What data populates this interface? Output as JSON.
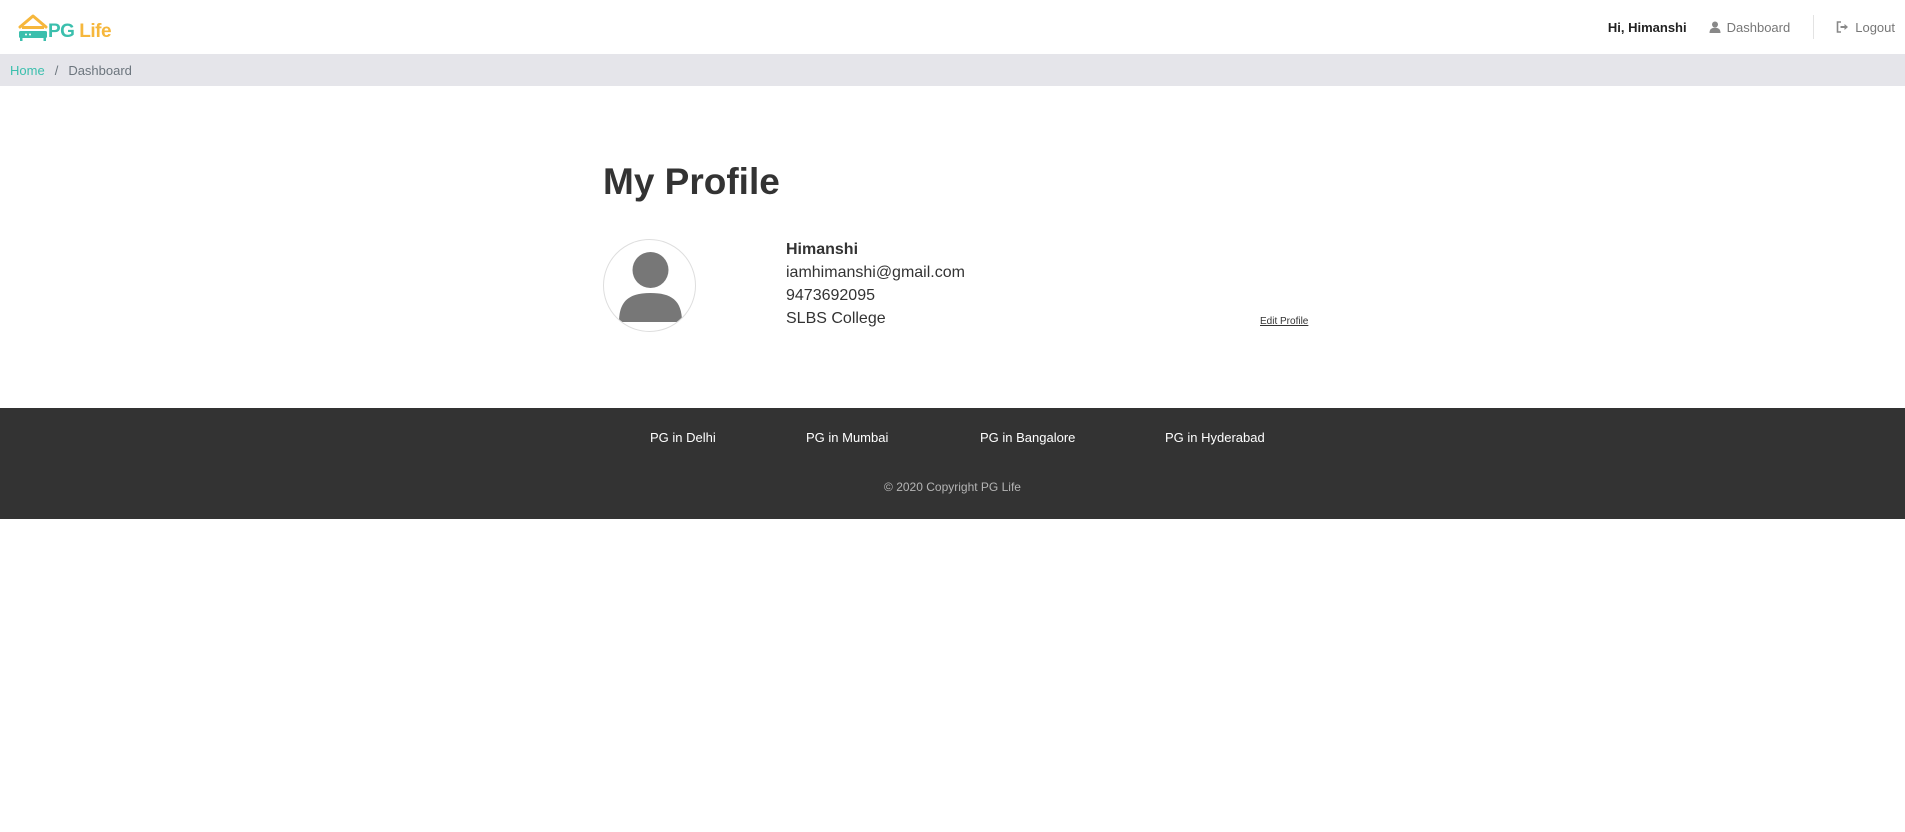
{
  "header": {
    "logo": {
      "part1": "PG",
      "part2": "Life",
      "icon": "house-bed-logo-icon"
    },
    "greeting": "Hi, Himanshi",
    "nav": {
      "dashboard": {
        "label": "Dashboard",
        "icon": "user-icon"
      },
      "logout": {
        "label": "Logout",
        "icon": "sign-out-icon"
      }
    }
  },
  "breadcrumb": {
    "home": "Home",
    "separator": "/",
    "current": "Dashboard"
  },
  "profile": {
    "title": "My Profile",
    "avatar_icon": "user-avatar-icon",
    "name": "Himanshi",
    "email": "iamhimanshi@gmail.com",
    "phone": "9473692095",
    "college": "SLBS College",
    "edit_label": "Edit Profile"
  },
  "footer": {
    "links": [
      "PG in Delhi",
      "PG in Mumbai",
      "PG in Bangalore",
      "PG in Hyderabad"
    ],
    "copyright": "© 2020 Copyright PG Life"
  },
  "colors": {
    "brand_teal": "#3bbfad",
    "brand_yellow": "#f6b73c",
    "breadcrumb_bg": "#e5e5ea",
    "footer_bg": "#333333"
  }
}
